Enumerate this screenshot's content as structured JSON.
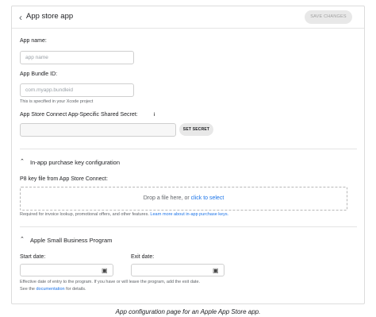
{
  "header": {
    "title": "App store app",
    "save_label": "SAVE CHANGES"
  },
  "app_name": {
    "label": "App name:",
    "placeholder": "app name"
  },
  "bundle_id": {
    "label": "App Bundle ID:",
    "placeholder": "com.myapp.bundleid",
    "help": "This is specified in your Xcode project"
  },
  "shared_secret": {
    "label": "App Store Connect App-Specific Shared Secret:",
    "value": "",
    "button": "SET SECRET"
  },
  "iap_section": {
    "title": "In-app purchase key configuration",
    "p8_label": "P8 key file from App Store Connect:",
    "drop_text": "Drop a file here, or ",
    "drop_link": "click to select",
    "help_text": "Required for invoice lookup, promotional offers, and other features. ",
    "help_link": "Learn more about in-app purchase keys."
  },
  "small_business": {
    "title": "Apple Small Business Program",
    "start_label": "Start date:",
    "exit_label": "Exit date:",
    "help_line1": "Effective date of entry to the program. If you have or will leave the program, add the exit date.",
    "help_line2_pre": "See the ",
    "help_line2_link": "documentation",
    "help_line2_post": " for details."
  },
  "caption": "App configuration page for an Apple App Store app."
}
